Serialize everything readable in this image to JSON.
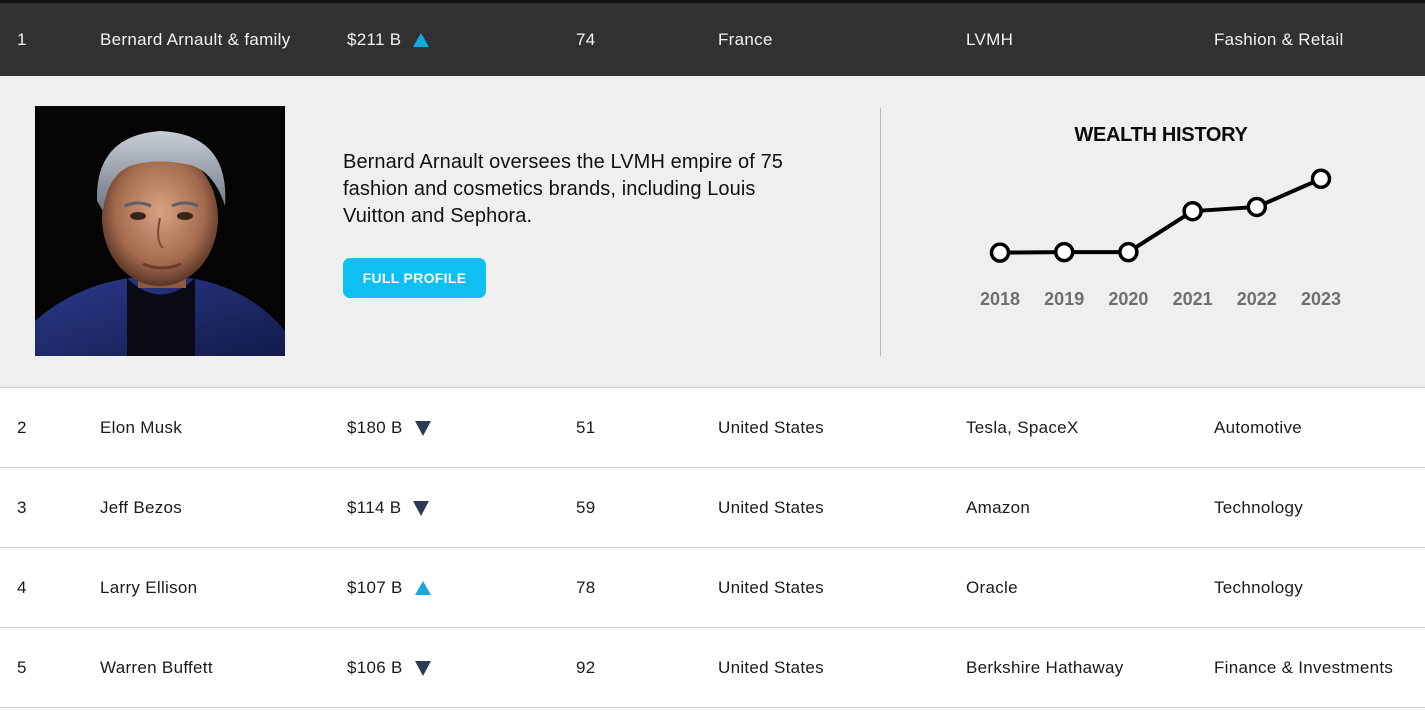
{
  "rows": [
    {
      "rank": "1",
      "name": "Bernard Arnault & family",
      "worth": "$211 B",
      "trend": "up",
      "age": "74",
      "country": "France",
      "source": "LVMH",
      "industry": "Fashion & Retail"
    },
    {
      "rank": "2",
      "name": "Elon Musk",
      "worth": "$180 B",
      "trend": "down",
      "age": "51",
      "country": "United States",
      "source": "Tesla, SpaceX",
      "industry": "Automotive"
    },
    {
      "rank": "3",
      "name": "Jeff Bezos",
      "worth": "$114 B",
      "trend": "down",
      "age": "59",
      "country": "United States",
      "source": "Amazon",
      "industry": "Technology"
    },
    {
      "rank": "4",
      "name": "Larry Ellison",
      "worth": "$107 B",
      "trend": "up",
      "age": "78",
      "country": "United States",
      "source": "Oracle",
      "industry": "Technology"
    },
    {
      "rank": "5",
      "name": "Warren Buffett",
      "worth": "$106 B",
      "trend": "down",
      "age": "92",
      "country": "United States",
      "source": "Berkshire Hathaway",
      "industry": "Finance & Investments"
    }
  ],
  "detail": {
    "bio": "Bernard Arnault oversees the LVMH empire of 75 fashion and cosmetics brands, including Louis Vuitton and Sephora.",
    "button_label": "FULL PROFILE",
    "wealth_history_title": "WEALTH HISTORY"
  },
  "chart_data": {
    "type": "line",
    "title": "WEALTH HISTORY",
    "x": [
      "2018",
      "2019",
      "2020",
      "2021",
      "2022",
      "2023"
    ],
    "values": [
      72,
      73,
      73,
      150,
      158,
      211
    ],
    "ylim": [
      60,
      220
    ],
    "grid": false,
    "legend": "none"
  },
  "colors": {
    "active_row_bg": "#313131",
    "up_arrow": "#14a8e3",
    "down_arrow": "#2e3a55",
    "button": "#0ec0f2",
    "detail_bg": "#efefef"
  },
  "icons": {
    "up": "trend-up-triangle-icon",
    "down": "trend-down-triangle-icon"
  }
}
